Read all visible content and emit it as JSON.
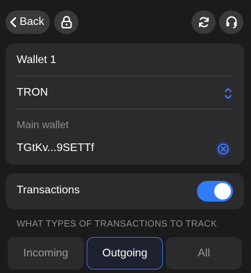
{
  "header": {
    "back_label": "Back"
  },
  "icons": {
    "back": "chevron-left-icon",
    "lock": "lock-icon",
    "refresh": "refresh-icon",
    "support": "headset-icon",
    "network_select": "up-down-chevron-icon",
    "clear": "clear-circle-icon"
  },
  "wallet": {
    "name": "Wallet 1",
    "network": "TRON",
    "wallet_type": "Main wallet",
    "address": "TGtKv...9SETTf"
  },
  "transactions": {
    "label": "Transactions",
    "enabled": true,
    "section_title": "WHAT TYPES OF TRANSACTIONS TO TRACK",
    "options": [
      "Incoming",
      "Outgoing",
      "All"
    ],
    "selected": "Outgoing"
  },
  "colors": {
    "background": "#1b1b1c",
    "card": "#2b2b2d",
    "accent": "#2f7cf6",
    "selected_border": "#3d6fe0",
    "muted_text": "#8e8e93"
  }
}
